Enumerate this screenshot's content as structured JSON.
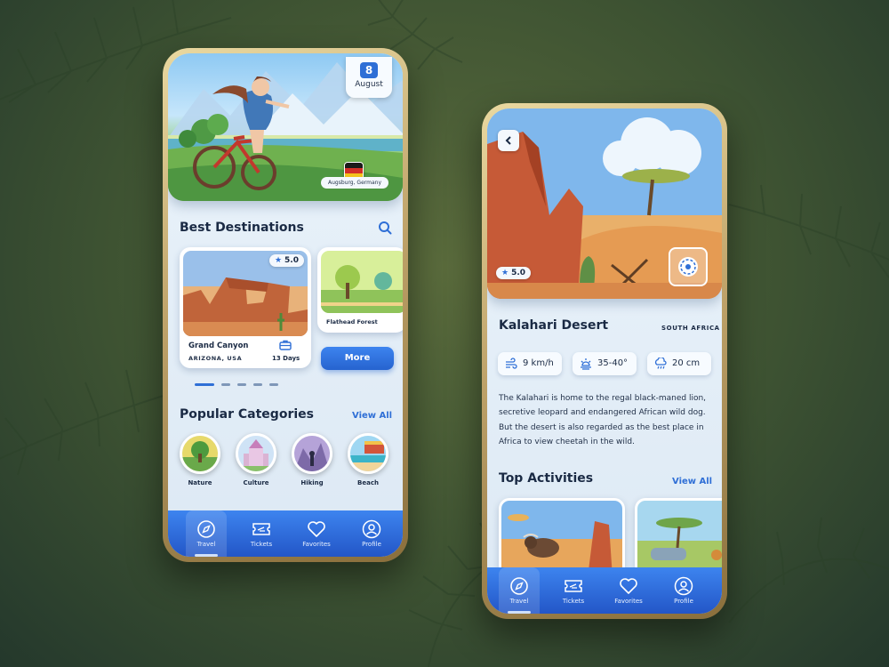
{
  "left_phone": {
    "hero": {
      "date_day": "8",
      "date_month": "August",
      "location": "Augsburg, Germany"
    },
    "best_destinations": {
      "title": "Best Destinations",
      "cards": [
        {
          "rating": "5.0",
          "name": "Grand Canyon",
          "location": "ARIZONA, USA",
          "duration": "13 Days"
        },
        {
          "name": "Flathead Forest"
        }
      ],
      "more_label": "More",
      "carousel_dots": 5,
      "active_dot": 0
    },
    "popular_categories": {
      "title": "Popular Categories",
      "view_all": "View All",
      "items": [
        {
          "label": "Nature"
        },
        {
          "label": "Culture"
        },
        {
          "label": "Hiking"
        },
        {
          "label": "Beach"
        }
      ]
    }
  },
  "nav": {
    "items": [
      {
        "label": "Travel",
        "icon": "compass-icon",
        "active": true
      },
      {
        "label": "Tickets",
        "icon": "ticket-icon",
        "active": false
      },
      {
        "label": "Favorites",
        "icon": "heart-icon",
        "active": false
      },
      {
        "label": "Profile",
        "icon": "user-icon",
        "active": false
      }
    ]
  },
  "right_phone": {
    "hero": {
      "rating": "5.0"
    },
    "title": "Kalahari Desert",
    "country": "SOUTH AFRICA",
    "stats": {
      "wind": "9 km/h",
      "temperature": "35-40°",
      "rain": "20 cm"
    },
    "description": "The Kalahari is home to the regal black-maned lion, secretive leopard and endangered African wild dog. But the desert is also regarded as the best place in Africa to view cheetah in the wild.",
    "top_activities": {
      "title": "Top Activities",
      "view_all": "View All"
    }
  },
  "colors": {
    "accent": "#2f6fd6",
    "nav_gradient_top": "#3d84ef",
    "nav_gradient_bottom": "#2356c7",
    "frame_gold": "#bfa36a",
    "background": "#3d5232"
  }
}
